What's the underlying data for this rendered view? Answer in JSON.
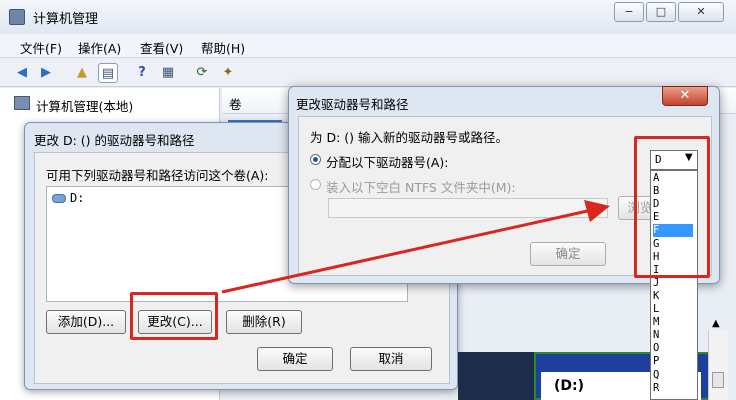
{
  "window": {
    "title": "计算机管理",
    "caption_buttons": [
      "−",
      "□",
      "✕"
    ]
  },
  "menubar": [
    "文件(F)",
    "操作(A)",
    "查看(V)",
    "帮助(H)"
  ],
  "toolbar": [
    "back-arrow-icon",
    "forward-arrow-icon",
    "up-folder-icon",
    "console-tree-icon",
    "help-icon",
    "properties-icon",
    "refresh-icon",
    "action-icon"
  ],
  "tree": {
    "root_label": "计算机管理(本地)"
  },
  "list": {
    "column_volume": "卷"
  },
  "dialog_change": {
    "title": "更改 D: () 的驱动器号和路径",
    "description": "可用下列驱动器号和路径访问这个卷(A):",
    "paths": [
      "D:"
    ],
    "buttons": {
      "add": "添加(D)...",
      "change": "更改(C)...",
      "remove": "删除(R)"
    },
    "ok": "确定",
    "cancel": "取消"
  },
  "dialog_assign": {
    "title": "更改驱动器号和路径",
    "close": "✕",
    "prompt": "为 D: () 输入新的驱动器号或路径。",
    "option_assign": "分配以下驱动器号(A):",
    "option_mount": "装入以下空白 NTFS 文件夹中(M):",
    "browse": "浏览",
    "ok": "确定",
    "selected_letter": "D",
    "letters": [
      "A",
      "B",
      "D",
      "E",
      "F",
      "G",
      "H",
      "I",
      "J",
      "K",
      "L",
      "M",
      "N",
      "O",
      "P",
      "Q",
      "R"
    ],
    "highlighted_letter": "F"
  },
  "disk_view": {
    "label": "(D:)"
  },
  "colors": {
    "annotation_red": "#d9271e",
    "selection_blue": "#3399ff"
  }
}
